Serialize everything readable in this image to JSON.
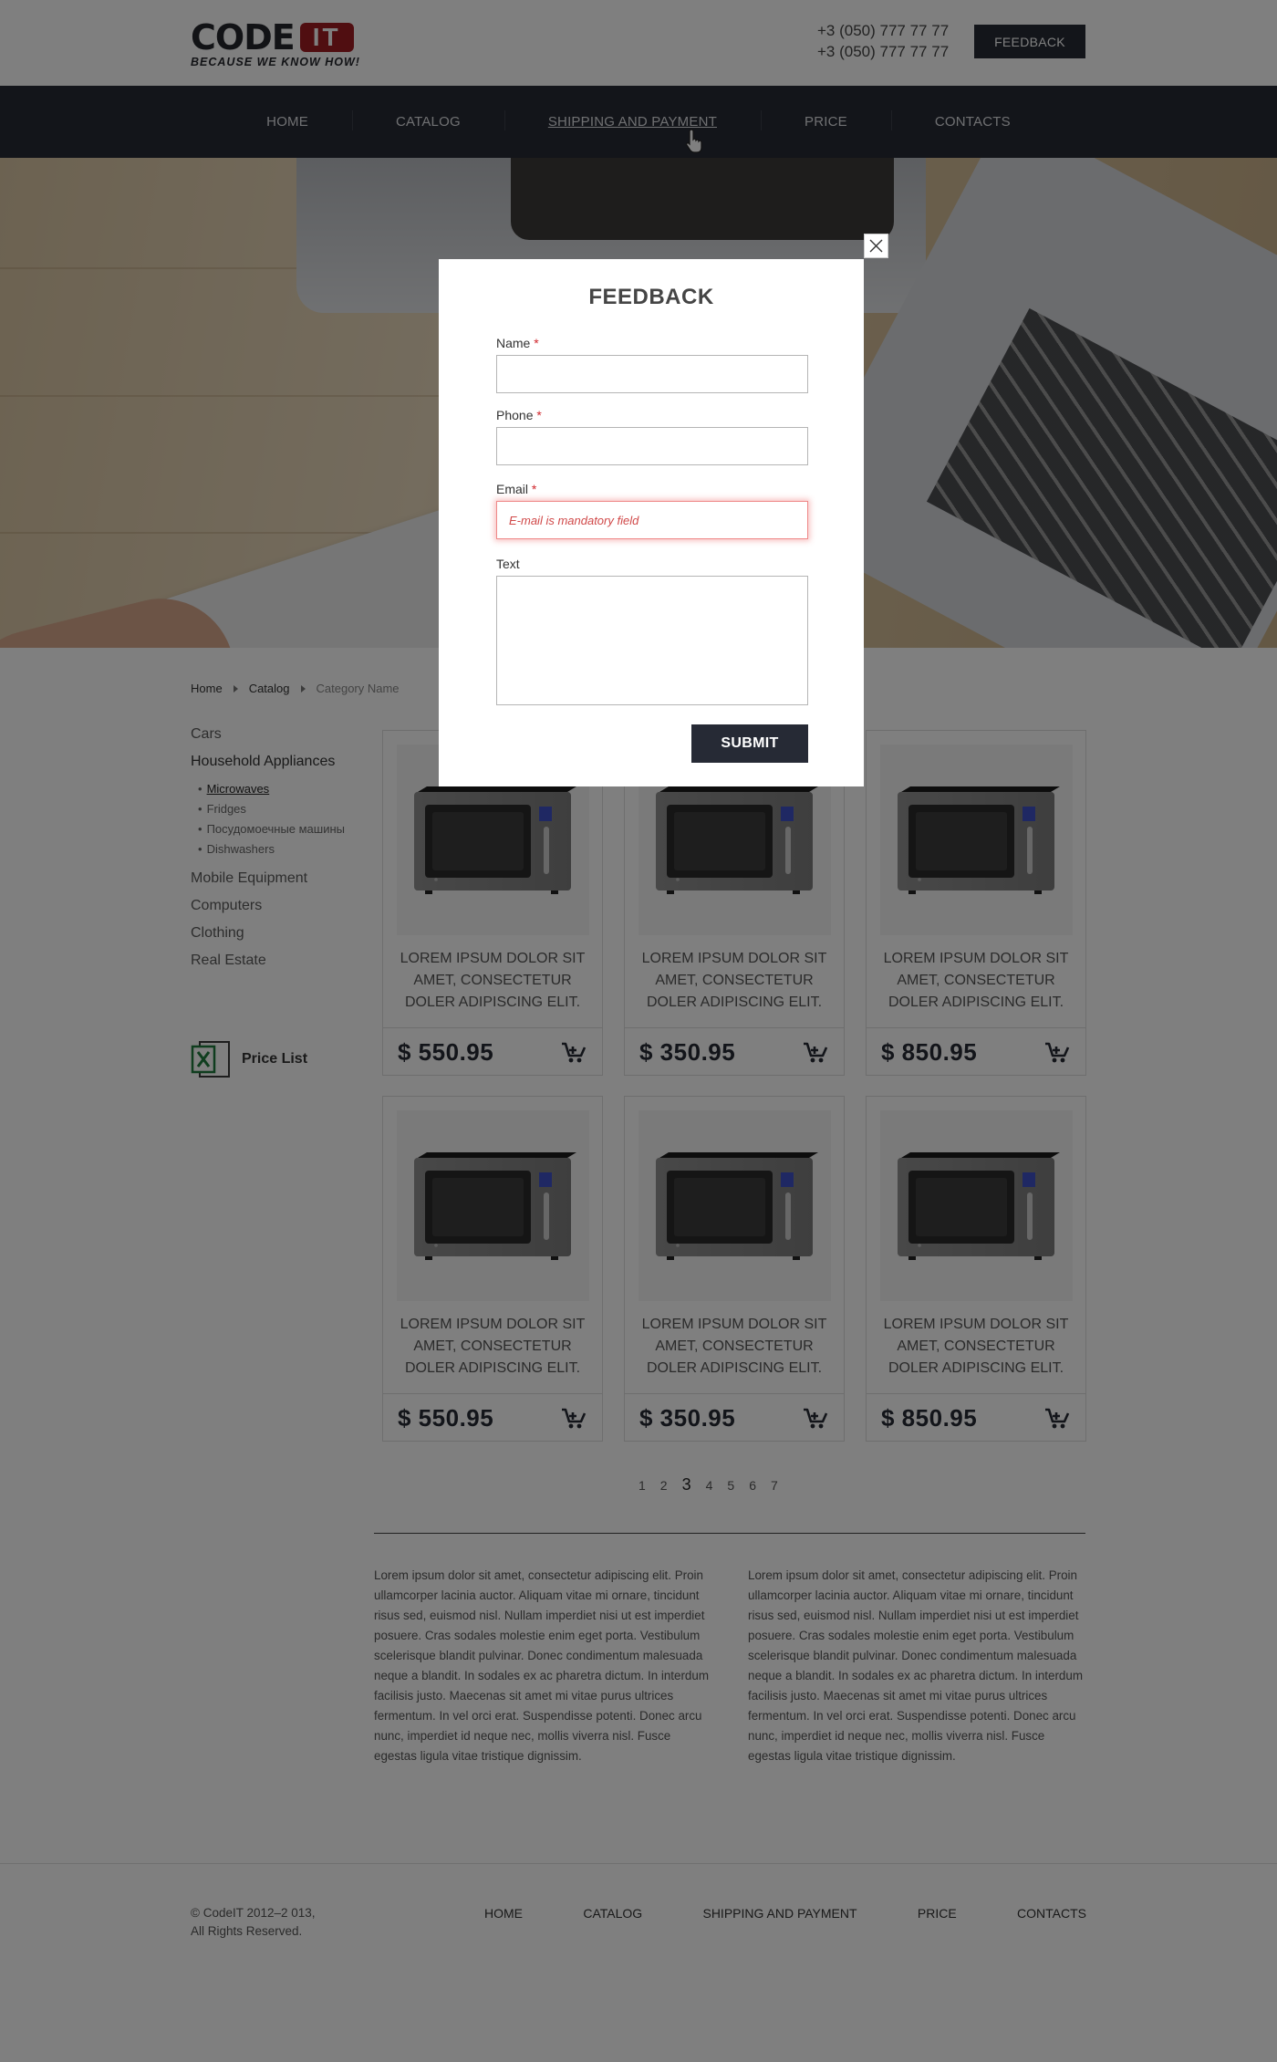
{
  "header": {
    "logo": {
      "code": "CODE",
      "it": "IT",
      "tagline": "BECAUSE WE KNOW HOW!"
    },
    "phones": [
      "+3 (050) 777 77 77",
      "+3 (050) 777 77 77"
    ],
    "feedback_button": "FEEDBACK"
  },
  "nav": {
    "items": [
      "HOME",
      "CATALOG",
      "SHIPPING AND PAYMENT",
      "PRICE",
      "CONTACTS"
    ],
    "active": "SHIPPING AND PAYMENT"
  },
  "breadcrumbs": [
    "Home",
    "Catalog",
    "Category Name"
  ],
  "sidebar": {
    "categories_top": [
      "Cars",
      "Household Appliances"
    ],
    "subcategories": [
      "Microwaves",
      "Fridges",
      "Посудомоечные машины",
      "Dishwashers"
    ],
    "active_subcategory": "Microwaves",
    "categories_bottom": [
      "Mobile Equipment",
      "Computers",
      "Clothing",
      "Real Estate"
    ],
    "price_list": "Price List"
  },
  "products": [
    {
      "title": "LOREM IPSUM DOLOR SIT AMET, CONSECTETUR DOLER ADIPISCING ELIT.",
      "price": "$ 550.95"
    },
    {
      "title": "LOREM IPSUM DOLOR SIT AMET, CONSECTETUR DOLER ADIPISCING ELIT.",
      "price": "$ 350.95"
    },
    {
      "title": "LOREM IPSUM DOLOR SIT AMET, CONSECTETUR DOLER ADIPISCING ELIT.",
      "price": "$ 850.95"
    },
    {
      "title": "LOREM IPSUM DOLOR SIT AMET, CONSECTETUR DOLER ADIPISCING ELIT.",
      "price": "$ 550.95"
    },
    {
      "title": "LOREM IPSUM DOLOR SIT AMET, CONSECTETUR DOLER ADIPISCING ELIT.",
      "price": "$ 350.95"
    },
    {
      "title": "LOREM IPSUM DOLOR SIT AMET, CONSECTETUR DOLER ADIPISCING ELIT.",
      "price": "$ 850.95"
    }
  ],
  "pagination": {
    "pages": [
      "1",
      "2",
      "3",
      "4",
      "5",
      "6",
      "7"
    ],
    "current": "3"
  },
  "seo_text": [
    "Lorem ipsum dolor sit amet, consectetur adipiscing elit. Proin ullamcorper lacinia auctor. Aliquam vitae mi ornare, tincidunt risus sed, euismod nisl. Nullam imperdiet nisi ut est imperdiet posuere. Cras sodales molestie enim eget porta. Vestibulum scelerisque blandit pulvinar. Donec condimentum malesuada neque a blandit. In sodales ex ac pharetra dictum. In interdum facilisis justo. Maecenas sit amet mi vitae purus ultrices fermentum. In vel orci erat. Suspendisse potenti. Donec arcu nunc, imperdiet id neque nec, mollis viverra nisl. Fusce egestas ligula vitae tristique dignissim.",
    "Lorem ipsum dolor sit amet, consectetur adipiscing elit. Proin ullamcorper lacinia auctor. Aliquam vitae mi ornare, tincidunt risus sed, euismod nisl. Nullam imperdiet nisi ut est imperdiet posuere. Cras sodales molestie enim eget porta. Vestibulum scelerisque blandit pulvinar. Donec condimentum malesuada neque a blandit. In sodales ex ac pharetra dictum. In interdum facilisis justo. Maecenas sit amet mi vitae purus ultrices fermentum. In vel orci erat. Suspendisse potenti. Donec arcu nunc, imperdiet id neque nec, mollis viverra nisl. Fusce egestas ligula vitae tristique dignissim."
  ],
  "footer": {
    "copyright_line1": "© CodeIT 2012–2 013,",
    "copyright_line2": "All Rights Reserved.",
    "nav": [
      "HOME",
      "CATALOG",
      "SHIPPING AND PAYMENT",
      "PRICE",
      "CONTACTS"
    ]
  },
  "modal": {
    "title": "FEEDBACK",
    "name_label": "Name",
    "phone_label": "Phone",
    "email_label": "Email",
    "required_mark": "*",
    "email_error_placeholder": "E-mail is mandatory field",
    "text_label": "Text",
    "submit": "SUBMIT",
    "name_value": "",
    "phone_value": ""
  },
  "colors": {
    "brand_dark": "#262a35",
    "brand_red": "#a01c22",
    "error": "#d04848"
  },
  "icons": {
    "close": "close-icon",
    "cart": "cart-icon",
    "excel": "excel-icon",
    "cursor": "hand-cursor-icon"
  }
}
